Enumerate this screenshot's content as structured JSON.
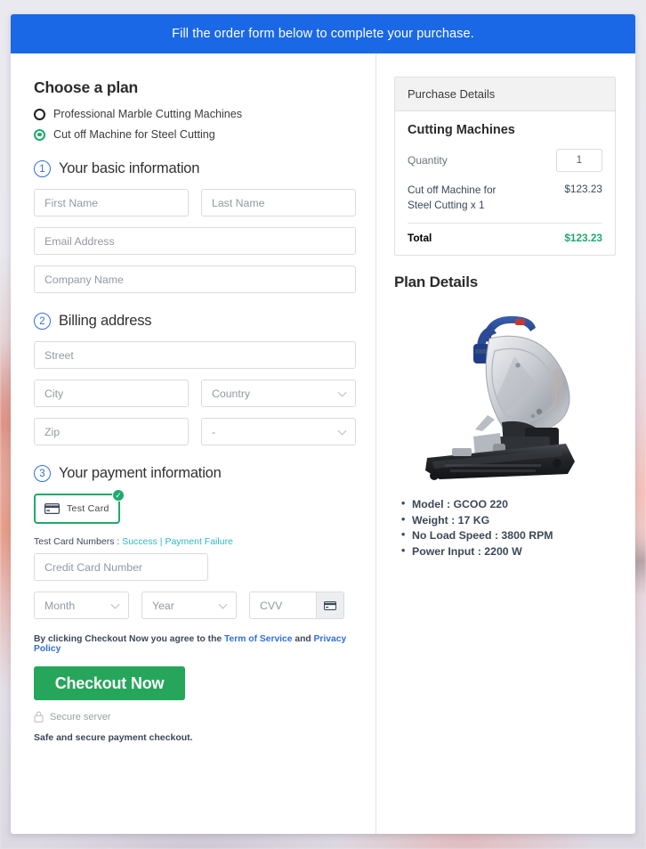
{
  "banner": {
    "text": "Fill the order form below to complete your purchase."
  },
  "plan": {
    "heading": "Choose a plan",
    "options": [
      {
        "label": "Professional Marble Cutting Machines",
        "selected": false
      },
      {
        "label": "Cut off Machine for Steel Cutting",
        "selected": true
      }
    ]
  },
  "steps": {
    "basic": {
      "number": "1",
      "title": "Your basic information",
      "fields": {
        "first_name": "First Name",
        "last_name": "Last Name",
        "email": "Email Address",
        "company": "Company Name"
      }
    },
    "billing": {
      "number": "2",
      "title": "Billing address",
      "fields": {
        "street": "Street",
        "city": "City",
        "country": "Country",
        "zip": "Zip",
        "state": "-"
      }
    },
    "payment": {
      "number": "3",
      "title": "Your payment information",
      "method_label": "Test  Card",
      "test_prefix": "Test Card Numbers : ",
      "test_success": "Success",
      "test_separator": " | ",
      "test_failure": "Payment Failure",
      "card_number": "Credit Card Number",
      "month": "Month",
      "year": "Year",
      "cvv": "CVV"
    }
  },
  "footer": {
    "agree_prefix": "By clicking Checkout Now you agree to the ",
    "terms": "Term of Service",
    "agree_mid": " and ",
    "privacy": "Privacy Policy",
    "checkout_label": "Checkout Now",
    "secure_server": "Secure server",
    "safe_note": "Safe and secure payment checkout."
  },
  "purchase": {
    "header": "Purchase Details",
    "title": "Cutting Machines",
    "quantity_label": "Quantity",
    "quantity_value": "1",
    "line_item_name": "Cut off Machine for Steel Cutting x 1",
    "line_item_amount": "$123.23",
    "total_label": "Total",
    "total_amount": "$123.23"
  },
  "plan_details": {
    "heading": "Plan Details",
    "image_alt": "cut-off-machine-photo",
    "specs": [
      "Model : GCOO 220",
      "Weight : 17 KG",
      "No Load Speed : 3800 RPM",
      "Power Input : 2200 W"
    ]
  },
  "colors": {
    "banner_blue": "#1a68e5",
    "accent_green": "#1eaa6d",
    "checkout_green": "#26a65b",
    "link_teal": "#2fb7c3",
    "link_blue": "#2f6fdb"
  }
}
